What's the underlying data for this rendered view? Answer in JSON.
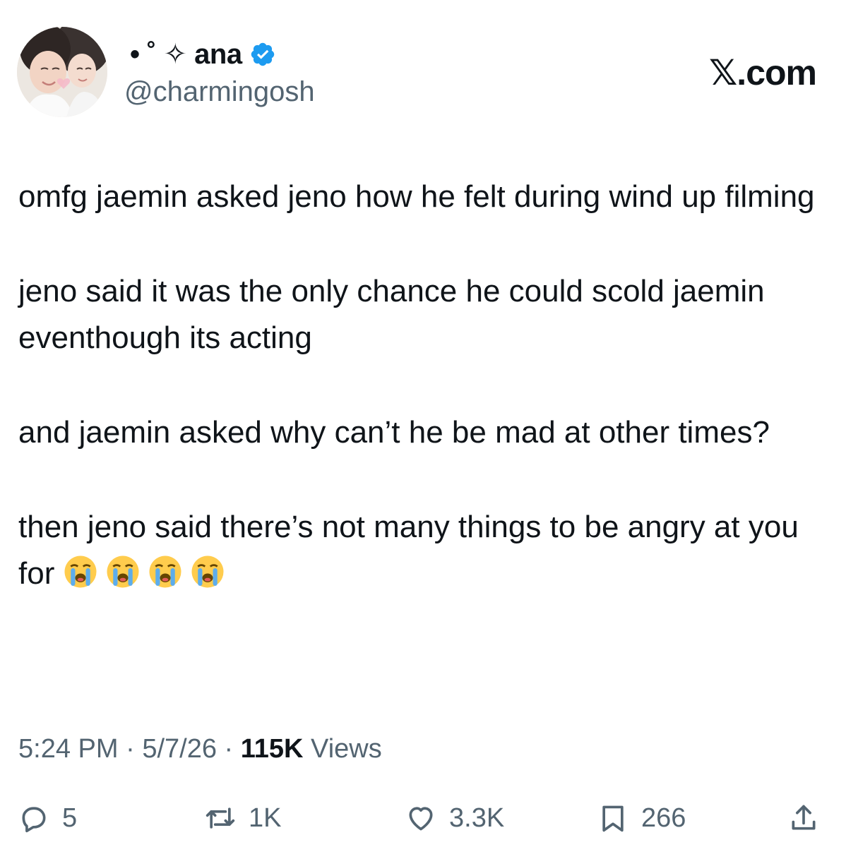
{
  "author": {
    "display_name": "• ˚ ✧ ana",
    "handle": "@charmingosh",
    "verified_icon": "verified-badge-icon",
    "avatar_icon": "profile-avatar"
  },
  "brand": {
    "label": "𝕏.com",
    "accent": "#1d9bf0"
  },
  "tweet": {
    "paragraphs": [
      "omfg jaemin asked jeno how he felt during wind up filming",
      "jeno said it was the only chance he could scold jaemin eventhough its acting",
      "and jaemin asked why can’t he be mad at other times?",
      "then jeno said there’s not many things to be angry at you for"
    ],
    "trailing_emoji": "😭😭😭😭"
  },
  "meta": {
    "time": "5:24 PM",
    "separator": " · ",
    "date": "5/7/26",
    "views_count": "115K",
    "views_label": " Views"
  },
  "actions": {
    "replies": "5",
    "reposts": "1K",
    "likes": "3.3K",
    "bookmarks": "266"
  },
  "colors": {
    "text": "#0f1419",
    "secondary": "#536471",
    "verified": "#1d9bf0"
  }
}
